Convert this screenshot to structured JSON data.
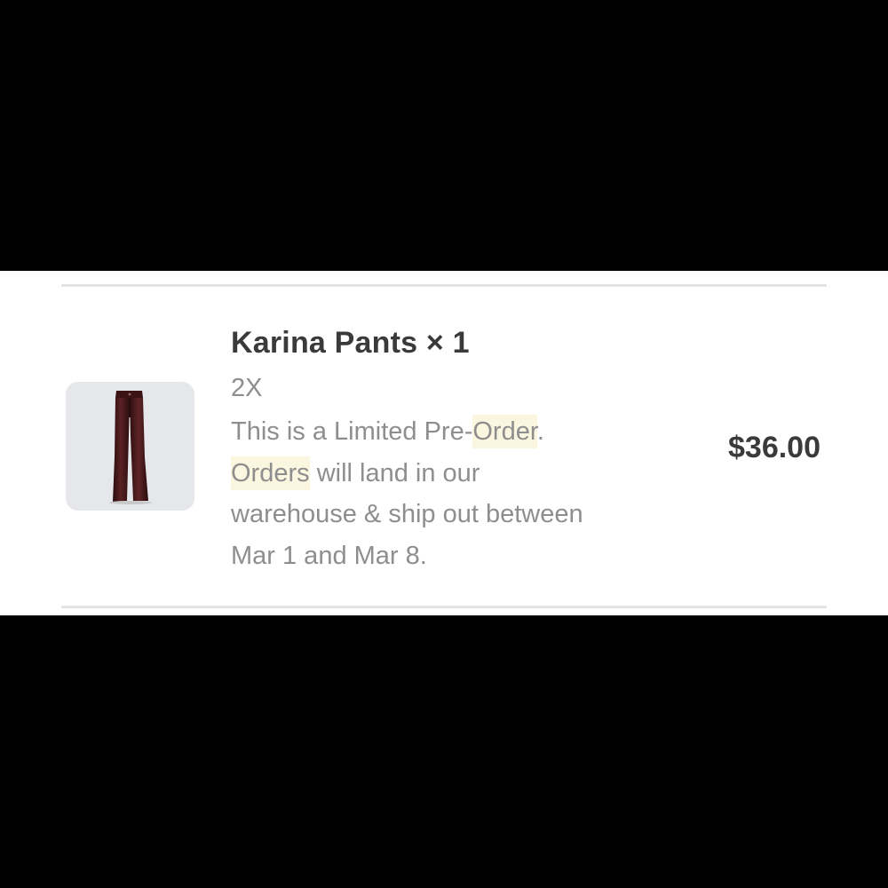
{
  "line_item": {
    "product_image": "pants-product-image",
    "title": "Karina Pants × 1",
    "variant": "2X",
    "note": {
      "line1_a": "This is a Limited Pre-",
      "line1_hl": "Order",
      "line1_b": ".",
      "line2_hl": "Orders",
      "line2_b": " will land in our",
      "line3": "warehouse & ship out between",
      "line4": "Mar 1 and Mar 8."
    },
    "price": "$36.00"
  },
  "colors": {
    "letterbox": "#000000",
    "panel": "#ffffff",
    "divider": "#e3e3e3",
    "title_text": "#3a3a3a",
    "muted_text": "#8e8e8e",
    "highlight": "#fbf6df",
    "thumb_bg": "#e6e7ea",
    "pants": "#3d1516"
  }
}
